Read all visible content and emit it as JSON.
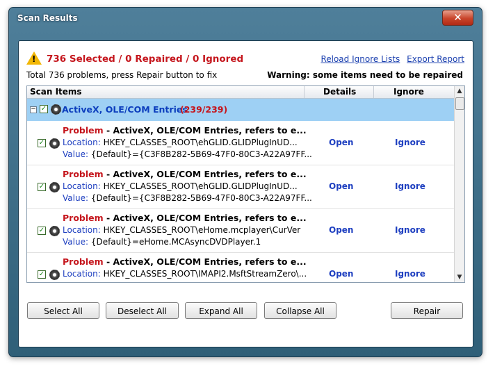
{
  "window": {
    "title": "Scan Results",
    "close_label": "✕"
  },
  "summary": {
    "headline": "736 Selected / 0 Repaired / 0 Ignored",
    "hint": "Total 736 problems, press Repair button to fix",
    "warning": "Warning: some items need to be repaired",
    "links": [
      "Reload Ignore Lists",
      "Export Report"
    ]
  },
  "list": {
    "columns": [
      "Scan Items",
      "Details",
      "Ignore"
    ],
    "group": {
      "name": "ActiveX, OLE/COM Entries",
      "count": "(239/239)",
      "expander": "−"
    },
    "items": [
      {
        "problem_label": "Problem",
        "problem_text": " - ActiveX, OLE/COM Entries, refers to e...",
        "location_label": "Location:",
        "location": " HKEY_CLASSES_ROOT\\ehGLID.GLIDPlugInUD...",
        "value_label": "Value:",
        "value": " {Default}={C3F8B282-5B69-47F0-80C3-A22A97FF...",
        "open": "Open",
        "ignore": "Ignore"
      },
      {
        "problem_label": "Problem",
        "problem_text": " - ActiveX, OLE/COM Entries, refers to e...",
        "location_label": "Location:",
        "location": " HKEY_CLASSES_ROOT\\ehGLID.GLIDPlugInUD...",
        "value_label": "Value:",
        "value": " {Default}={C3F8B282-5B69-47F0-80C3-A22A97FF...",
        "open": "Open",
        "ignore": "Ignore"
      },
      {
        "problem_label": "Problem",
        "problem_text": " - ActiveX, OLE/COM Entries, refers to e...",
        "location_label": "Location:",
        "location": " HKEY_CLASSES_ROOT\\eHome.mcplayer\\CurVer",
        "value_label": "Value:",
        "value": " {Default}=eHome.MCAsyncDVDPlayer.1",
        "open": "Open",
        "ignore": "Ignore"
      },
      {
        "problem_label": "Problem",
        "problem_text": " - ActiveX, OLE/COM Entries, refers to e...",
        "location_label": "Location:",
        "location": " HKEY_CLASSES_ROOT\\IMAPI2.MsftStreamZero\\...",
        "value_label": "",
        "value": "",
        "open": "Open",
        "ignore": "Ignore"
      }
    ]
  },
  "buttons": {
    "select_all": "Select All",
    "deselect_all": "Deselect All",
    "expand_all": "Expand All",
    "collapse_all": "Collapse All",
    "repair": "Repair"
  },
  "colors": {
    "accent_red": "#c5161d",
    "link_blue": "#1e3fc0",
    "group_highlight": "#9ed0f4"
  }
}
